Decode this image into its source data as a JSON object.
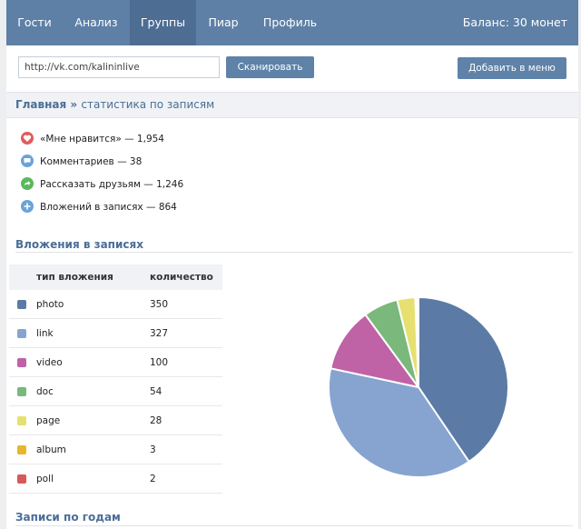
{
  "nav": {
    "items": [
      {
        "label": "Гости"
      },
      {
        "label": "Анализ"
      },
      {
        "label": "Группы"
      },
      {
        "label": "Пиар"
      },
      {
        "label": "Профиль"
      }
    ],
    "active_index": 2,
    "balance": "Баланс: 30 монет"
  },
  "scan": {
    "url_value": "http://vk.com/kalininlive",
    "scan_button": "Сканировать",
    "add_menu_button": "Добавить в меню"
  },
  "breadcrumb": {
    "home": "Главная",
    "separator": "»",
    "current": "статистика по записям"
  },
  "stats": [
    {
      "icon": "heart-icon",
      "color": "#e25b5b",
      "text": "«Мне нравится» — 1,954"
    },
    {
      "icon": "comment-icon",
      "color": "#6aa3d8",
      "text": "Комментариев — 38"
    },
    {
      "icon": "share-icon",
      "color": "#5bb85b",
      "text": "Рассказать друзьям — 1,246"
    },
    {
      "icon": "plus-icon",
      "color": "#6aa3d8",
      "text": "Вложений в записях — 864"
    }
  ],
  "attachments_section": {
    "title": "Вложения в записях",
    "col_type": "тип вложения",
    "col_count": "количество"
  },
  "chart_data": {
    "type": "pie",
    "categories": [
      "photo",
      "link",
      "video",
      "doc",
      "page",
      "album",
      "poll"
    ],
    "values": [
      350,
      327,
      100,
      54,
      28,
      3,
      2
    ],
    "colors": [
      "#5b7ba6",
      "#86a4cf",
      "#c062a6",
      "#7ab87c",
      "#e6e070",
      "#e8b62a",
      "#d65a5a"
    ]
  },
  "years_section": {
    "title": "Записи по годам"
  }
}
